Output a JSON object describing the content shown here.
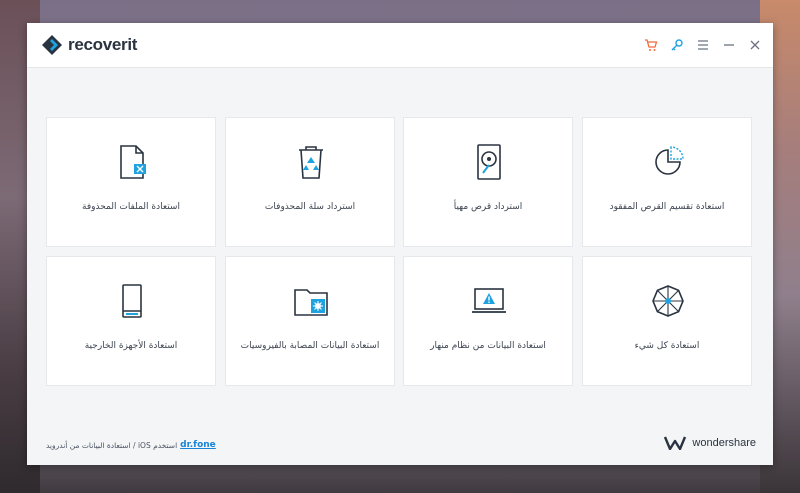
{
  "app": {
    "logo_text": "recoverit"
  },
  "title_icons": [
    {
      "name": "cart-icon",
      "color": "#f26a3c"
    },
    {
      "name": "key-icon",
      "color": "#1fa2e0"
    },
    {
      "name": "menu-icon",
      "color": "#6b7380"
    },
    {
      "name": "minimize-icon",
      "color": "#6b7380"
    },
    {
      "name": "close-icon",
      "color": "#6b7380"
    }
  ],
  "cards": [
    {
      "label": "استعادة الملفات المحذوفة",
      "icon": "deleted-file-icon"
    },
    {
      "label": "استرداد سلة المحذوفات",
      "icon": "recycle-bin-icon"
    },
    {
      "label": "استرداد قرص مهيأ",
      "icon": "formatted-disk-icon"
    },
    {
      "label": "استعادة تقسيم القرص المفقود",
      "icon": "lost-partition-icon"
    },
    {
      "label": "استعادة الأجهزة الخارجية",
      "icon": "external-device-icon"
    },
    {
      "label": "استعادة البيانات المصابة بالفيروسيات",
      "icon": "virus-folder-icon"
    },
    {
      "label": "استعادة البيانات من نظام منهار",
      "icon": "crashed-system-icon"
    },
    {
      "label": "استعادة كل شيء",
      "icon": "all-around-icon"
    }
  ],
  "footer": {
    "text": "استخدم iOS / استعادة البيانات من أندرويد",
    "link": "dr.fone",
    "brand": "wondershare"
  },
  "colors": {
    "accent": "#1fa2e0",
    "icon_dark": "#2a3441"
  }
}
